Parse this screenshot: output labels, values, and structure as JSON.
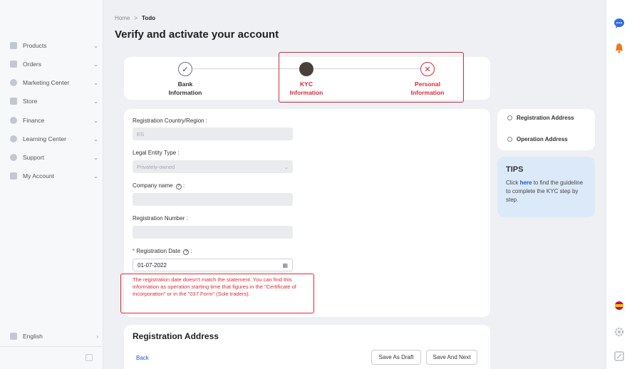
{
  "sidebar": {
    "items": [
      {
        "label": "Products"
      },
      {
        "label": "Orders"
      },
      {
        "label": "Marketing Center"
      },
      {
        "label": "Store"
      },
      {
        "label": "Finance"
      },
      {
        "label": "Learning Center"
      },
      {
        "label": "Support"
      },
      {
        "label": "My Account"
      }
    ],
    "language": "English"
  },
  "breadcrumb": {
    "home": "Home",
    "separator": ">",
    "current": "Todo"
  },
  "page_title": "Verify and activate your account",
  "stepper": {
    "steps": [
      {
        "line1": "Bank",
        "line2": "Information",
        "state": "done"
      },
      {
        "line1": "KYC",
        "line2": "Information",
        "state": "current"
      },
      {
        "line1": "Personal",
        "line2": "Information",
        "state": "error"
      }
    ],
    "icons": {
      "done": "✓",
      "error": "✕"
    }
  },
  "form": {
    "country_label": "Registration Country/Region :",
    "country_value": "ES",
    "entity_label": "Legal Entity Type :",
    "entity_value": "Privately-owned",
    "company_label": "Company name",
    "company_value": "",
    "reg_number_label": "Registration Number :",
    "reg_number_value": "",
    "reg_date_required": "*",
    "reg_date_label": "Registration Date",
    "reg_date_value": "01-07-2022",
    "error_message": "The registration date doesn't match the statement. You can find this information as operation starting time that figures in the \"Certificate of Incorporation\" or in the \"037 Form\" (Sole traders)."
  },
  "anchors": {
    "items": [
      "Registration Address",
      "Operation Address"
    ]
  },
  "tips": {
    "title": "TIPS",
    "text_before": "Click ",
    "link": "here",
    "text_after": " to find the guideline to complete the KYC step by step."
  },
  "bottom": {
    "title": "Registration Address",
    "back": "Back",
    "save_draft": "Save As Draft",
    "save_next": "Save And Next"
  },
  "colors": {
    "accent": "#1a56db",
    "error": "#d92b3a",
    "current_step": "#4a403a"
  }
}
